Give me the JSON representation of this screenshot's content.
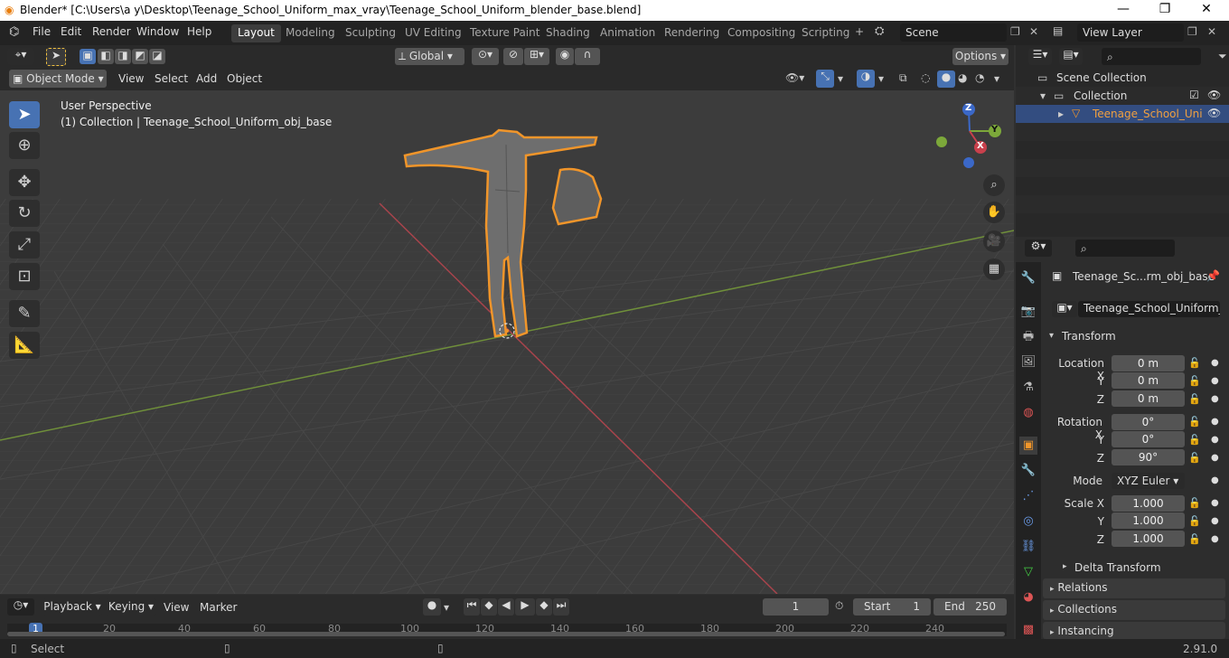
{
  "window": {
    "title": "Blender* [C:\\Users\\a y\\Desktop\\Teenage_School_Uniform_max_vray\\Teenage_School_Uniform_blender_base.blend]",
    "minimize": "—",
    "maximize": "❐",
    "close": "✕"
  },
  "menu": [
    "File",
    "Edit",
    "Render",
    "Window",
    "Help"
  ],
  "workspaces": [
    "Layout",
    "Modeling",
    "Sculpting",
    "UV Editing",
    "Texture Paint",
    "Shading",
    "Animation",
    "Rendering",
    "Compositing",
    "Scripting"
  ],
  "active_workspace": "Layout",
  "scene": "Scene",
  "view_layer": "View Layer",
  "header": {
    "transform_orientation": "Global",
    "options": "Options",
    "mode": "Object Mode",
    "view_menu": [
      "View",
      "Select",
      "Add",
      "Object"
    ]
  },
  "viewport": {
    "perspective": "User Perspective",
    "collection_info": "(1) Collection | Teenage_School_Uniform_obj_base",
    "gizmo": {
      "x": "X",
      "y": "Y",
      "z": "Z"
    }
  },
  "outliner": {
    "scene_collection": "Scene Collection",
    "collection": "Collection",
    "object": "Teenage_School_Uni"
  },
  "properties": {
    "object_name": "Teenage_Sc...rm_obj_base",
    "data_name": "Teenage_School_Uniform_o...",
    "transform": "Transform",
    "location_label": "Location X",
    "location": [
      "0 m",
      "0 m",
      "0 m"
    ],
    "rotation_label": "Rotation X",
    "rotation": [
      "0°",
      "0°",
      "90°"
    ],
    "mode_label": "Mode",
    "mode": "XYZ Euler",
    "scale_label": "Scale X",
    "scale": [
      "1.000",
      "1.000",
      "1.000"
    ],
    "y": "Y",
    "z": "Z",
    "delta": "Delta Transform",
    "relations": "Relations",
    "collections": "Collections",
    "instancing": "Instancing"
  },
  "timeline": {
    "menus": [
      "Playback",
      "Keying",
      "View",
      "Marker"
    ],
    "current_frame": "1",
    "start_label": "Start",
    "start": "1",
    "end_label": "End",
    "end": "250",
    "ticks": [
      "1",
      "20",
      "40",
      "60",
      "80",
      "100",
      "120",
      "140",
      "160",
      "180",
      "200",
      "220",
      "240"
    ]
  },
  "status": {
    "select": "Select",
    "version": "2.91.0"
  },
  "colors": {
    "accent": "#4772b3",
    "selection_outline": "#f0952a",
    "x_axis": "#b3424a",
    "y_axis": "#7aa33a"
  }
}
